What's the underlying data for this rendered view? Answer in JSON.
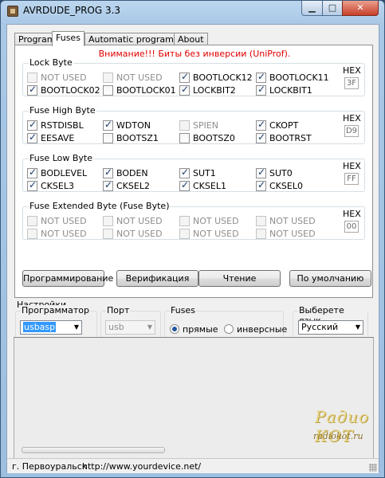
{
  "window": {
    "title": "AVRDUDE_PROG 3.3",
    "min_label": "▁",
    "max_label": "□",
    "close_label": "✕"
  },
  "tabs": [
    {
      "label": "Program"
    },
    {
      "label": "Fuses"
    },
    {
      "label": "Automatic programming"
    },
    {
      "label": "About"
    }
  ],
  "warning": "Внимание!!! Биты без инверсии (UniProf).",
  "lock_byte": {
    "title": "Lock Byte",
    "hex_label": "HEX",
    "hex_value": "3F",
    "row1": [
      {
        "label": "NOT USED",
        "checked": false,
        "disabled": true
      },
      {
        "label": "NOT USED",
        "checked": false,
        "disabled": true
      },
      {
        "label": "BOOTLOCK12",
        "checked": true,
        "disabled": false
      },
      {
        "label": "BOOTLOCK11",
        "checked": true,
        "disabled": false
      }
    ],
    "row2": [
      {
        "label": "BOOTLOCK02",
        "checked": true,
        "disabled": false
      },
      {
        "label": "BOOTLOCK01",
        "checked": false,
        "disabled": false
      },
      {
        "label": "LOCKBIT2",
        "checked": true,
        "disabled": false
      },
      {
        "label": "LOCKBIT1",
        "checked": true,
        "disabled": false
      }
    ]
  },
  "fuse_high": {
    "title": "Fuse High Byte",
    "hex_label": "HEX",
    "hex_value": "D9",
    "row1": [
      {
        "label": "RSTDISBL",
        "checked": true,
        "disabled": false
      },
      {
        "label": "WDTON",
        "checked": true,
        "disabled": false
      },
      {
        "label": "SPIEN",
        "checked": false,
        "disabled": true
      },
      {
        "label": "CKOPT",
        "checked": true,
        "disabled": false
      }
    ],
    "row2": [
      {
        "label": "EESAVE",
        "checked": true,
        "disabled": false
      },
      {
        "label": "BOOTSZ1",
        "checked": false,
        "disabled": false
      },
      {
        "label": "BOOTSZ0",
        "checked": false,
        "disabled": false
      },
      {
        "label": "BOOTRST",
        "checked": true,
        "disabled": false
      }
    ]
  },
  "fuse_low": {
    "title": "Fuse Low Byte",
    "hex_label": "HEX",
    "hex_value": "FF",
    "row1": [
      {
        "label": "BODLEVEL",
        "checked": true,
        "disabled": false
      },
      {
        "label": "BODEN",
        "checked": true,
        "disabled": false
      },
      {
        "label": "SUT1",
        "checked": true,
        "disabled": false
      },
      {
        "label": "SUT0",
        "checked": true,
        "disabled": false
      }
    ],
    "row2": [
      {
        "label": "CKSEL3",
        "checked": true,
        "disabled": false
      },
      {
        "label": "CKSEL2",
        "checked": true,
        "disabled": false
      },
      {
        "label": "CKSEL1",
        "checked": true,
        "disabled": false
      },
      {
        "label": "CKSEL0",
        "checked": true,
        "disabled": false
      }
    ]
  },
  "fuse_ext": {
    "title": "Fuse Extended Byte (Fuse Byte)",
    "hex_label": "HEX",
    "hex_value": "00",
    "row1": [
      {
        "label": "NOT USED",
        "checked": false,
        "disabled": true
      },
      {
        "label": "NOT USED",
        "checked": false,
        "disabled": true
      },
      {
        "label": "NOT USED",
        "checked": false,
        "disabled": true
      },
      {
        "label": "NOT USED",
        "checked": false,
        "disabled": true
      }
    ],
    "row2": [
      {
        "label": "NOT USED",
        "checked": false,
        "disabled": true
      },
      {
        "label": "NOT USED",
        "checked": false,
        "disabled": true
      },
      {
        "label": "NOT USED",
        "checked": false,
        "disabled": true
      },
      {
        "label": "NOT USED",
        "checked": false,
        "disabled": true
      }
    ]
  },
  "buttons": {
    "program": "Программирование",
    "verify": "Верификация",
    "read": "Чтение",
    "default": "По умолчанию"
  },
  "settings": {
    "title": "Настройки",
    "programmer_label": "Программатор",
    "programmer_value": "usbasp",
    "port_label": "Порт",
    "port_value": "usb",
    "fuses_label": "Fuses",
    "radio_direct": "прямые",
    "radio_inverse": "инверсные",
    "radio_selected": "direct",
    "language_label": "Выберете язык",
    "language_value": "Русский"
  },
  "watermark": {
    "line1": "Радио КОТ",
    "line2": "radiokot.ru"
  },
  "status": {
    "city": "г. Первоуральск",
    "url": "http://www.yourdevice.net/"
  }
}
